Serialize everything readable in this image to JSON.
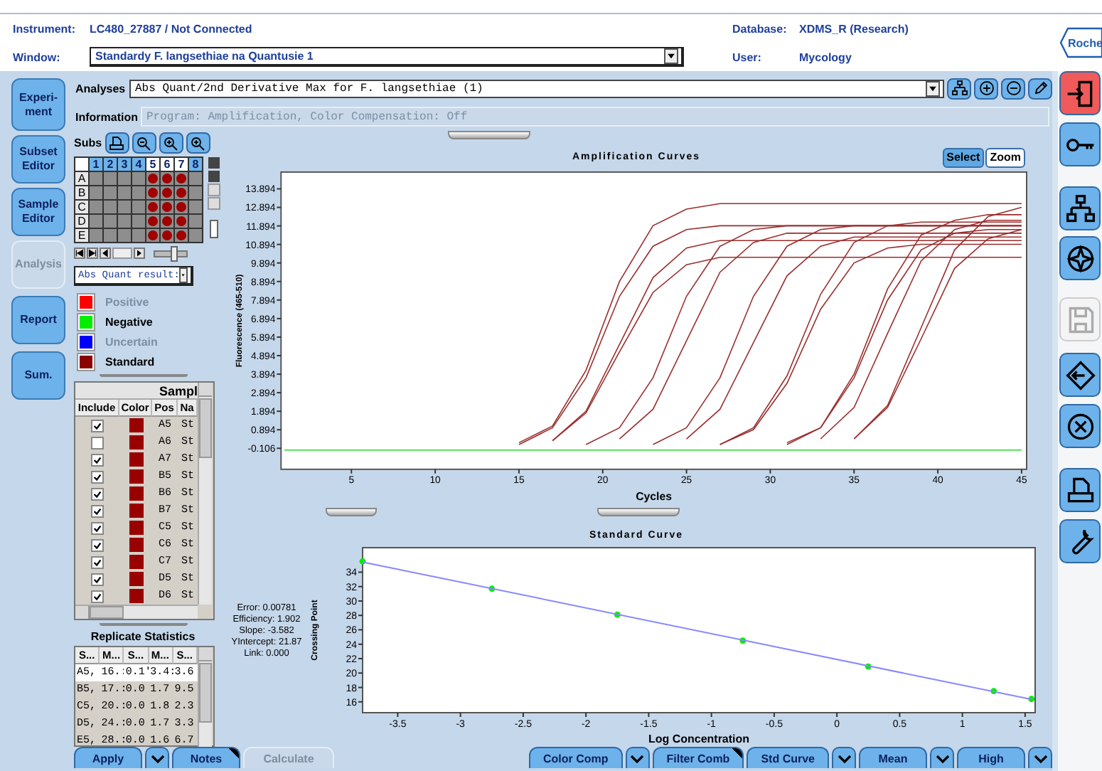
{
  "instrument": {
    "label": "Instrument:",
    "value": "LC480_27887 / Not Connected"
  },
  "database": {
    "label": "Database:",
    "value": "XDMS_R (Research)"
  },
  "window_field": {
    "label": "Window:",
    "value": "Standardy F. langsethiae na Quantusie 1"
  },
  "user": {
    "label": "User:",
    "value": "Mycology"
  },
  "logo": {
    "text": "Roche"
  },
  "nav": [
    {
      "label": "Experi-\nment",
      "disabled": false
    },
    {
      "label": "Subset\nEditor",
      "disabled": false
    },
    {
      "label": "Sample\nEditor",
      "disabled": false
    },
    {
      "label": "Analysis",
      "disabled": true
    },
    {
      "label": "Report",
      "disabled": false
    },
    {
      "label": "Sum.",
      "disabled": false
    }
  ],
  "analyses": {
    "label": "Analyses",
    "value": "Abs Quant/2nd Derivative Max for F. langsethiae (1)"
  },
  "information": {
    "label": "Information",
    "value": "Program: Amplification, Color Compensation: Off"
  },
  "subset": {
    "label": "Subs"
  },
  "plate": {
    "columns": [
      {
        "label": "1",
        "selected": false
      },
      {
        "label": "2",
        "selected": false
      },
      {
        "label": "3",
        "selected": false
      },
      {
        "label": "4",
        "selected": false
      },
      {
        "label": "5",
        "selected": true
      },
      {
        "label": "6",
        "selected": true
      },
      {
        "label": "7",
        "selected": true
      },
      {
        "label": "8",
        "selected": false
      }
    ],
    "rows": [
      {
        "label": "A",
        "wells": [
          false,
          false,
          false,
          false,
          true,
          true,
          true,
          false
        ]
      },
      {
        "label": "B",
        "wells": [
          false,
          false,
          false,
          false,
          true,
          true,
          true,
          false
        ]
      },
      {
        "label": "C",
        "wells": [
          false,
          false,
          false,
          false,
          true,
          true,
          true,
          false
        ]
      },
      {
        "label": "D",
        "wells": [
          false,
          false,
          false,
          false,
          true,
          true,
          true,
          false
        ]
      },
      {
        "label": "E",
        "wells": [
          false,
          false,
          false,
          false,
          true,
          true,
          true,
          false
        ]
      }
    ]
  },
  "plate_slider": {
    "level": 0.6
  },
  "result_select": {
    "value": "Abs Quant result:"
  },
  "legend": [
    {
      "label": "Positive",
      "color": "#ff0000",
      "disabled": true
    },
    {
      "label": "Negative",
      "color": "#00ee00",
      "disabled": false
    },
    {
      "label": "Uncertain",
      "color": "#0000ff",
      "disabled": true
    },
    {
      "label": "Standard",
      "color": "#8b0000",
      "disabled": false
    }
  ],
  "samples": {
    "title": "Sampl",
    "columns": [
      "Include",
      "Color",
      "Pos",
      "Na"
    ],
    "rows": [
      {
        "checked": true,
        "color": "#990000",
        "pos": "A5",
        "name": "St"
      },
      {
        "checked": false,
        "color": "#990000",
        "pos": "A6",
        "name": "St"
      },
      {
        "checked": true,
        "color": "#990000",
        "pos": "A7",
        "name": "St"
      },
      {
        "checked": true,
        "color": "#990000",
        "pos": "B5",
        "name": "St"
      },
      {
        "checked": true,
        "color": "#990000",
        "pos": "B6",
        "name": "St"
      },
      {
        "checked": true,
        "color": "#990000",
        "pos": "B7",
        "name": "St"
      },
      {
        "checked": true,
        "color": "#990000",
        "pos": "C5",
        "name": "St"
      },
      {
        "checked": true,
        "color": "#990000",
        "pos": "C6",
        "name": "St"
      },
      {
        "checked": true,
        "color": "#990000",
        "pos": "C7",
        "name": "St"
      },
      {
        "checked": true,
        "color": "#990000",
        "pos": "D5",
        "name": "St"
      },
      {
        "checked": true,
        "color": "#990000",
        "pos": "D6",
        "name": "St"
      }
    ]
  },
  "replicate_statistics": {
    "title": "Replicate Statistics",
    "columns": [
      "S...",
      "M...",
      "S...",
      "M...",
      "S..."
    ],
    "rows": [
      {
        "selected": true,
        "cells": [
          "A5,",
          "16.:",
          "0.1'",
          "3.4:",
          "3.6"
        ]
      },
      {
        "selected": false,
        "cells": [
          "B5,",
          "17.:",
          "0.0",
          "1.7",
          "9.5"
        ]
      },
      {
        "selected": false,
        "cells": [
          "C5,",
          "20.:",
          "0.0",
          "1.8",
          "2.3"
        ]
      },
      {
        "selected": false,
        "cells": [
          "D5,",
          "24.:",
          "0.0",
          "1.7",
          "3.3"
        ]
      },
      {
        "selected": false,
        "cells": [
          "E5,",
          "28.:",
          "0.0",
          "1.6",
          "6.7"
        ]
      }
    ]
  },
  "amplification": {
    "title": "Amplification Curves",
    "modes": [
      {
        "label": "Select",
        "selected": true
      },
      {
        "label": "Zoom",
        "selected": false
      }
    ],
    "chart_data": {
      "type": "line",
      "xlabel": "Cycles",
      "ylabel": "Fluorescence (465-510)",
      "x": [
        1,
        3,
        5,
        7,
        9,
        11,
        13,
        15,
        17,
        19,
        21,
        23,
        25,
        27,
        29,
        31,
        33,
        35,
        37,
        39,
        41,
        43,
        45
      ],
      "xlim": [
        0.8,
        45.3
      ],
      "ylim": [
        -1.24,
        14.8
      ],
      "xticks": [
        5,
        10,
        15,
        20,
        25,
        30,
        35,
        40,
        45
      ],
      "yticks": [
        -0.106,
        0.894,
        1.894,
        2.894,
        3.894,
        4.894,
        5.894,
        6.894,
        7.894,
        8.894,
        9.894,
        10.894,
        11.894,
        12.894,
        13.894
      ],
      "series": [
        {
          "color": "#9b2d2d",
          "values": [
            null,
            null,
            null,
            null,
            null,
            null,
            null,
            0.2,
            1.1,
            4.1,
            8.9,
            11.9,
            12.8,
            13.1,
            13.1,
            13.1,
            13.1,
            13.1,
            13.1,
            13.1,
            13.1,
            13.1,
            13.1
          ]
        },
        {
          "color": "#9b2d2d",
          "values": [
            null,
            null,
            null,
            null,
            null,
            null,
            null,
            0.1,
            1.0,
            3.7,
            8.1,
            10.8,
            11.7,
            11.9,
            11.9,
            11.9,
            11.9,
            11.9,
            11.9,
            11.9,
            11.9,
            11.9,
            11.9
          ]
        },
        {
          "color": "#9b2d2d",
          "values": [
            null,
            null,
            null,
            null,
            null,
            null,
            null,
            null,
            0.3,
            1.9,
            5.5,
            9.1,
            10.7,
            11.1,
            11.1,
            11.1,
            11.1,
            11.1,
            11.1,
            11.1,
            11.1,
            11.1,
            11.1
          ]
        },
        {
          "color": "#9b2d2d",
          "values": [
            null,
            null,
            null,
            null,
            null,
            null,
            null,
            null,
            0.3,
            1.8,
            5.1,
            8.3,
            9.8,
            10.2,
            10.2,
            10.2,
            10.2,
            10.2,
            10.2,
            10.2,
            10.2,
            10.2,
            10.2
          ]
        },
        {
          "color": "#9b2d2d",
          "values": [
            null,
            null,
            null,
            null,
            null,
            null,
            null,
            null,
            null,
            0.1,
            1.0,
            3.7,
            8.1,
            10.8,
            11.7,
            11.9,
            11.9,
            11.9,
            11.9,
            11.9,
            11.9,
            11.9,
            11.9
          ]
        },
        {
          "color": "#9b2d2d",
          "values": [
            null,
            null,
            null,
            null,
            null,
            null,
            null,
            null,
            null,
            null,
            0.4,
            2.0,
            5.7,
            9.4,
            11.0,
            11.5,
            11.5,
            11.5,
            11.5,
            11.5,
            11.5,
            11.5,
            11.5
          ]
        },
        {
          "color": "#9b2d2d",
          "values": [
            null,
            null,
            null,
            null,
            null,
            null,
            null,
            null,
            null,
            null,
            null,
            0.1,
            1.0,
            3.7,
            8.1,
            10.8,
            11.7,
            11.9,
            11.9,
            11.9,
            11.9,
            11.9,
            11.9
          ]
        },
        {
          "color": "#9b2d2d",
          "values": [
            null,
            null,
            null,
            null,
            null,
            null,
            null,
            null,
            null,
            null,
            null,
            null,
            0.4,
            2.0,
            5.6,
            9.2,
            10.8,
            11.3,
            11.3,
            11.3,
            11.3,
            11.3,
            11.3
          ]
        },
        {
          "color": "#9b2d2d",
          "values": [
            null,
            null,
            null,
            null,
            null,
            null,
            null,
            null,
            null,
            null,
            null,
            null,
            null,
            0.1,
            1.0,
            3.8,
            8.2,
            11.0,
            11.9,
            12.1,
            12.1,
            12.1,
            12.1
          ]
        },
        {
          "color": "#9b2d2d",
          "values": [
            null,
            null,
            null,
            null,
            null,
            null,
            null,
            null,
            null,
            null,
            null,
            null,
            null,
            0.1,
            0.9,
            3.4,
            7.4,
            9.9,
            10.7,
            10.9,
            10.9,
            10.9,
            10.9
          ]
        },
        {
          "color": "#9b2d2d",
          "values": [
            null,
            null,
            null,
            null,
            null,
            null,
            null,
            null,
            null,
            null,
            null,
            null,
            null,
            null,
            null,
            0.2,
            1.0,
            3.9,
            8.5,
            11.4,
            12.2,
            12.5,
            12.5
          ]
        },
        {
          "color": "#9b2d2d",
          "values": [
            null,
            null,
            null,
            null,
            null,
            null,
            null,
            null,
            null,
            null,
            null,
            null,
            null,
            null,
            null,
            0.1,
            1.0,
            3.7,
            7.9,
            10.6,
            11.5,
            11.7,
            11.7
          ]
        },
        {
          "color": "#9b2d2d",
          "values": [
            null,
            null,
            null,
            null,
            null,
            null,
            null,
            null,
            null,
            null,
            null,
            null,
            null,
            null,
            null,
            null,
            0.4,
            2.1,
            6.1,
            10.0,
            11.7,
            12.2,
            12.2
          ]
        },
        {
          "color": "#9b2d2d",
          "values": [
            null,
            null,
            null,
            null,
            null,
            null,
            null,
            null,
            null,
            null,
            null,
            null,
            null,
            null,
            null,
            null,
            null,
            0.4,
            2.2,
            6.4,
            10.6,
            12.4,
            12.9
          ]
        },
        {
          "color": "#9b2d2d",
          "values": [
            null,
            null,
            null,
            null,
            null,
            null,
            null,
            null,
            null,
            null,
            null,
            null,
            null,
            null,
            null,
            null,
            null,
            0.4,
            2.1,
            5.8,
            9.6,
            11.2,
            11.7
          ]
        },
        {
          "color": "#22dd22",
          "values": [
            -0.2,
            -0.2,
            -0.2,
            -0.2,
            -0.2,
            -0.2,
            -0.2,
            -0.2,
            -0.2,
            -0.2,
            -0.2,
            -0.2,
            -0.2,
            -0.2,
            -0.2,
            -0.2,
            -0.2,
            -0.2,
            -0.2,
            -0.2,
            -0.2,
            -0.2,
            -0.2
          ]
        }
      ]
    }
  },
  "standard_curve": {
    "title": "Standard Curve",
    "stats": [
      "Error: 0.00781",
      "Efficiency: 1.902",
      "Slope: -3.582",
      "YIntercept: 21.87",
      "Link: 0.000"
    ],
    "chart_data": {
      "type": "scatter",
      "xlabel": "Log Concentration",
      "ylabel": "Crossing Point",
      "x": [
        -3.78,
        -2.75,
        -1.75,
        -0.75,
        0.25,
        1.25,
        1.55
      ],
      "xlim": [
        -3.78,
        1.58
      ],
      "ylim": [
        14.5,
        37.4
      ],
      "xticks": [
        -3.5,
        -3,
        -2.5,
        -2,
        -1.5,
        -1,
        -0.5,
        0,
        0.5,
        1,
        1.5
      ],
      "yticks": [
        16,
        18,
        20,
        22,
        24,
        26,
        28,
        30,
        32,
        34
      ],
      "series": [
        {
          "color": "#00ee00",
          "values": [
            35.5,
            31.7,
            28.1,
            24.5,
            20.9,
            17.5,
            16.4
          ]
        }
      ]
    }
  },
  "bottom_buttons": [
    {
      "label": "Apply",
      "dropdown": true,
      "corner": false,
      "disabled": false
    },
    {
      "label": "Notes",
      "dropdown": false,
      "corner": true,
      "disabled": false
    },
    {
      "label": "Calculate",
      "dropdown": false,
      "corner": false,
      "disabled": true
    },
    {
      "label": "Color Comp",
      "dropdown": true,
      "corner": false,
      "disabled": false
    },
    {
      "label": "Filter Comb",
      "dropdown": false,
      "corner": true,
      "disabled": false
    },
    {
      "label": "Std Curve",
      "dropdown": true,
      "corner": false,
      "disabled": false
    },
    {
      "label": "Mean",
      "dropdown": true,
      "corner": false,
      "disabled": false
    },
    {
      "label": "High",
      "dropdown": true,
      "corner": false,
      "disabled": false
    }
  ],
  "rail": [
    {
      "kind": "exit",
      "disabled": false
    },
    {
      "kind": "key",
      "disabled": false
    },
    {
      "kind": "tree",
      "disabled": false
    },
    {
      "kind": "compass",
      "disabled": false
    },
    {
      "kind": "save",
      "disabled": true
    },
    {
      "kind": "back",
      "disabled": false
    },
    {
      "kind": "cancel",
      "disabled": false
    },
    {
      "kind": "print",
      "disabled": false
    },
    {
      "kind": "wrench",
      "disabled": false
    }
  ]
}
